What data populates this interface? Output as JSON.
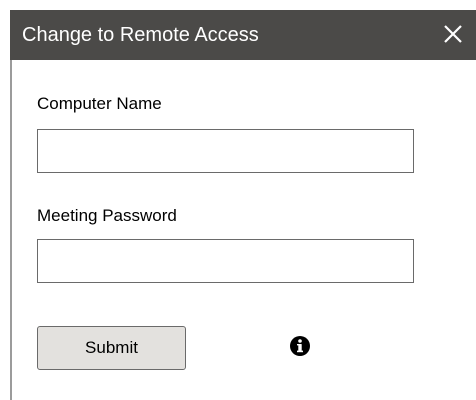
{
  "window": {
    "title": "Change to Remote Access",
    "close_icon": "close-icon"
  },
  "form": {
    "computer_name_label": "Computer Name",
    "computer_name_value": "",
    "meeting_password_label": "Meeting Password",
    "meeting_password_value": "",
    "submit_label": "Submit",
    "info_icon": "info-icon"
  },
  "colors": {
    "titlebar_bg": "#4b4a48",
    "titlebar_text": "#ffffff",
    "button_bg": "#e3e1de",
    "border": "#6a6a6a"
  }
}
